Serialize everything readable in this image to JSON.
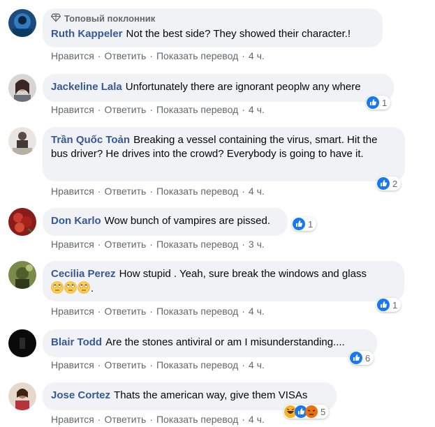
{
  "badge_label": "Топовый поклонник",
  "actions": {
    "like": "Нравится",
    "reply": "Ответить",
    "translate": "Показать перевод",
    "sep": "·"
  },
  "colors": {
    "bubble": "#f0f2f5",
    "author": "#385898",
    "like_blue": "#1877f2",
    "meta": "#65676b"
  },
  "comments": [
    {
      "author": "Ruth Kappeler",
      "text": "Not the best side? They showed their character.!",
      "time": "4 ч.",
      "reactions": null
    },
    {
      "author": "Jackeline Lala",
      "text": "Unfortunately there are ignorant peoplw any where",
      "time": "4 ч.",
      "reactions": "1"
    },
    {
      "author": "Trần Quốc Toản",
      "text": "Breaking a vessel containing the virus, smart. Hit the bus driver? He drives into the crowd? Everybody is going to have it.",
      "time": "4 ч.",
      "reactions": "2"
    },
    {
      "author": "Don Karlo",
      "text": "Wow bunch of vampires are pissed.",
      "time": "3 ч.",
      "reactions": "1"
    },
    {
      "author": "Cecilia Perez",
      "text": "How stupid . Yeah, sure break the windows and glass",
      "text_end": ".",
      "time": "4 ч.",
      "reactions": "1"
    },
    {
      "author": "Blair Todd",
      "text": "Are the stones antiviral or am I misunderstanding....",
      "time": "4 ч.",
      "reactions": "6"
    },
    {
      "author": "Jose Cortez",
      "text": "Thats the american way, give them VISAs",
      "time": "4 ч.",
      "reactions": "5"
    }
  ]
}
